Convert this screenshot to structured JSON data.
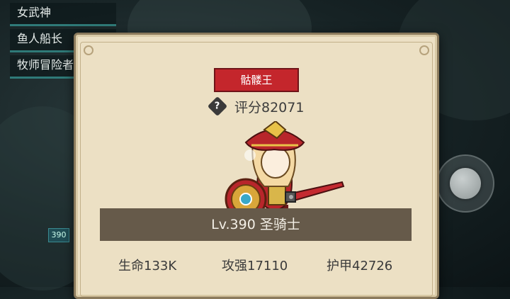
{
  "side_list": [
    "女武神",
    "鱼人船长",
    "牧师冒险者"
  ],
  "hp_tag": "390",
  "card": {
    "boss_label": "骷髅王",
    "rating_icon": "question-diamond-icon",
    "rating": "评分82071",
    "level_class": "Lv.390 圣骑士",
    "stats": {
      "hp": "生命133K",
      "atk": "攻强17110",
      "armor": "护甲42726"
    }
  },
  "colors": {
    "panel_bg": "#ece0c4",
    "boss_tag": "#c4262c",
    "level_bar": "#665a4a"
  }
}
